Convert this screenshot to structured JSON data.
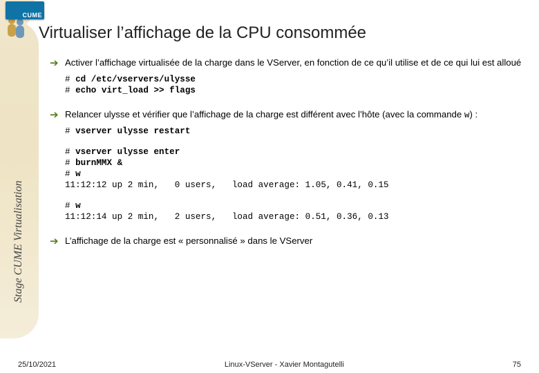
{
  "logo": {
    "text": "CUME"
  },
  "title": "Virtualiser l’affichage de la CPU consommée",
  "bullets": {
    "b1": "Activer l’affichage virtualisée de la charge dans le VServer, en fonction de ce qu’il utilise et de ce qui lui est alloué",
    "b3": "L’affichage de la charge est « personnalisé » dans le VServer"
  },
  "bullet2": {
    "pre": "Relancer ulysse et vérifier que l’affichage de la charge est différent avec l’hôte (avec la commande ",
    "cmd": "w",
    "post": ") :"
  },
  "code": {
    "block1_l1": "# cd /etc/vservers/ulysse",
    "block1_l2": "# echo virt_load >> flags",
    "block2_l1": "# vserver ulysse restart",
    "block3_l1": "# vserver ulysse enter",
    "block3_l2": "# burnMMX &",
    "block3_l3": "# w",
    "block3_l4": "11:12:12 up 2 min,   0 users,   load average: 1.05, 0.41, 0.15",
    "block4_l1": "# w",
    "block4_l2": "11:12:14 up 2 min,   2 users,   load average: 0.51, 0.36, 0.13"
  },
  "side_text": "Stage CUME Virtualisation",
  "footer": {
    "date": "25/10/2021",
    "center": "Linux-VServer - Xavier Montagutelli",
    "page": "75"
  }
}
